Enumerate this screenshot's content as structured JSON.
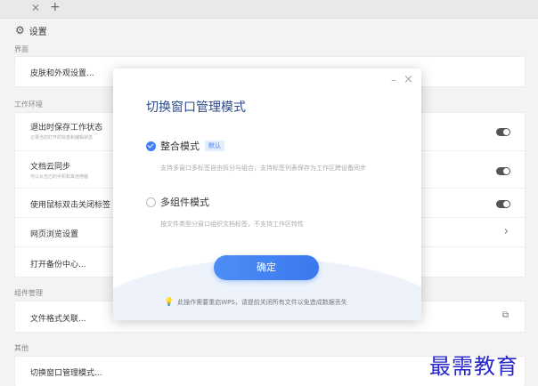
{
  "tabbar": {
    "close_icon": "close-icon",
    "add_icon": "plus-icon"
  },
  "settings": {
    "icon": "gear-icon",
    "title": "设置"
  },
  "sections": {
    "interface": {
      "label": "界面",
      "skin": "皮肤和外观设置..."
    },
    "workenv": {
      "label": "工作环境",
      "items": [
        {
          "title": "退出时保存工作状态",
          "sub": "记录当前打开的标签和编辑状态"
        },
        {
          "title": "文档云同步",
          "sub": "可以从自己的手机和其他电脑"
        },
        {
          "title": "使用鼠标双击关闭标签",
          "sub": ""
        },
        {
          "title": "网页浏览设置",
          "sub": ""
        },
        {
          "title": "打开备份中心...",
          "sub": ""
        }
      ]
    },
    "components": {
      "label": "组件管理",
      "item": "文件格式关联..."
    },
    "other": {
      "label": "其他",
      "item": "切换窗口管理模式..."
    }
  },
  "dialog": {
    "title": "切换窗口管理模式",
    "minimize": "–",
    "close": "×",
    "option1": {
      "label": "整合模式",
      "badge": "默认",
      "desc": "支持多窗口多标签自由拆分与组合，支持标签列表保存为工作区跨设备同步",
      "selected": true
    },
    "option2": {
      "label": "多组件模式",
      "desc": "按文件类型分窗口组织文档标签，不支持工作区特性",
      "selected": false
    },
    "confirm": "确定",
    "tip": "此操作需要重启WPS，请提前关闭所有文件以免造成数据丢失"
  },
  "watermark": "最需教育",
  "colors": {
    "accent": "#3f7ff0",
    "title_blue": "#2d4a8a",
    "watermark": "#2626c9"
  }
}
